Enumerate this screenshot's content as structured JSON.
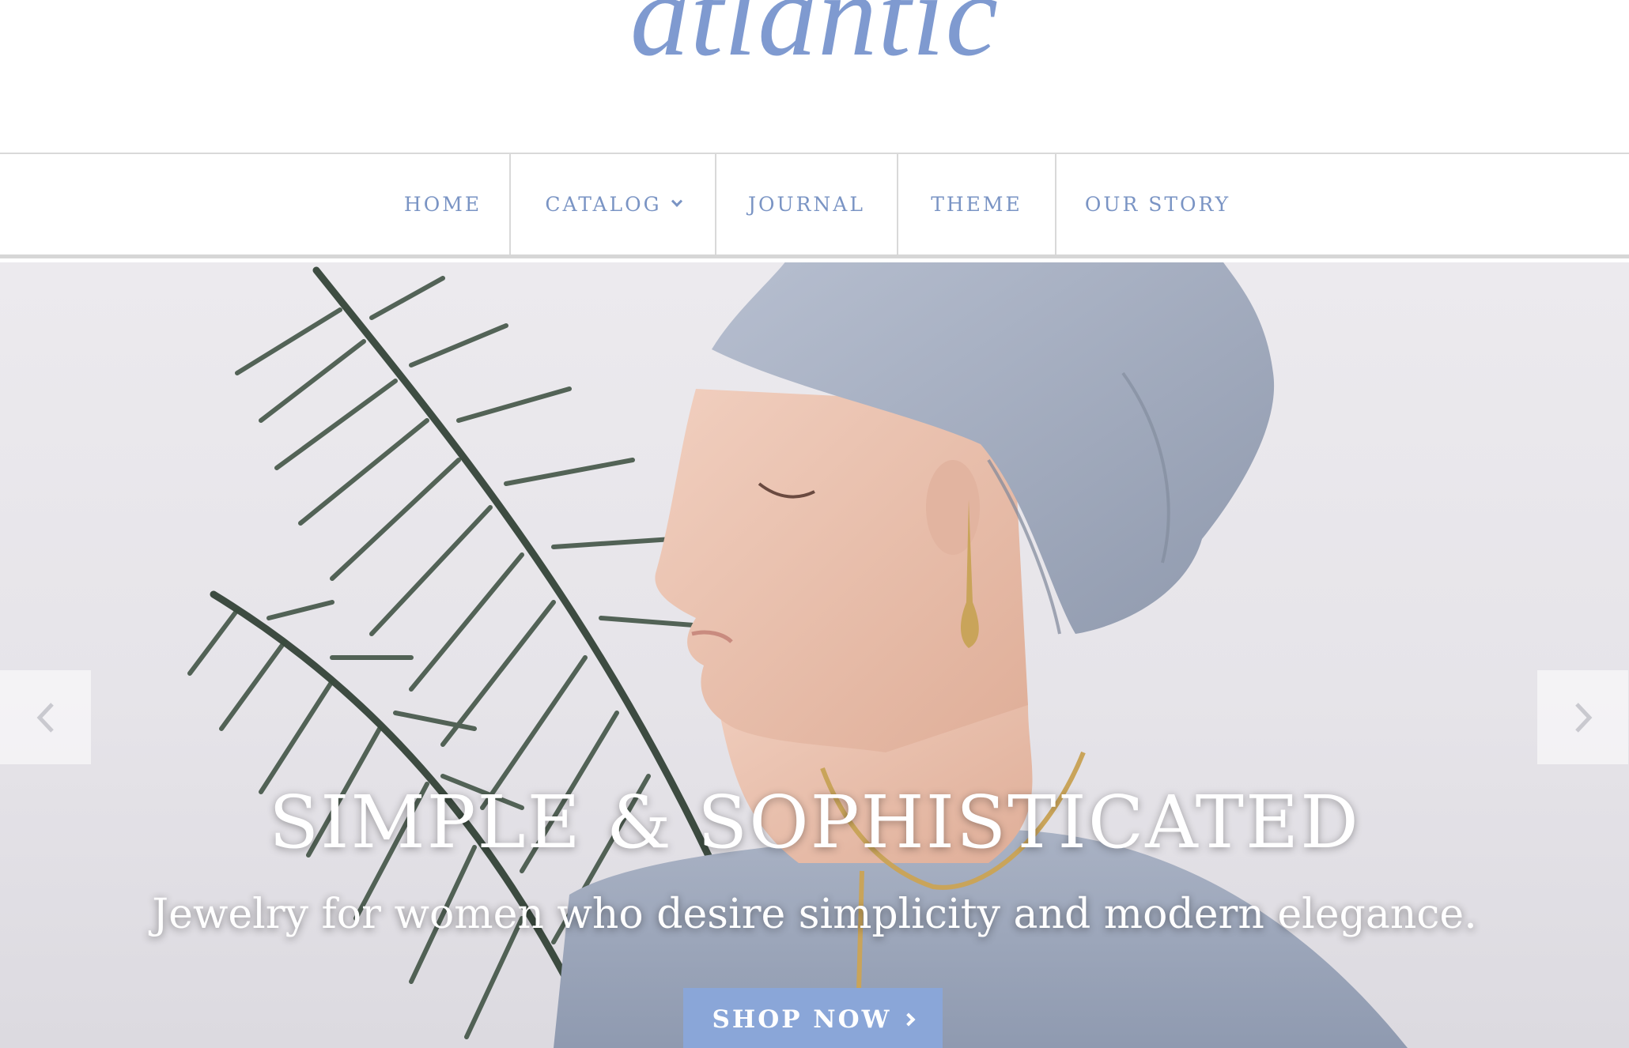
{
  "brand": {
    "logo_text": "atlantic",
    "accent": "#7f9ad0"
  },
  "nav": {
    "items": [
      {
        "label": "HOME"
      },
      {
        "label": "CATALOG",
        "has_dropdown": true
      },
      {
        "label": "JOURNAL"
      },
      {
        "label": "THEME"
      },
      {
        "label": "OUR STORY"
      }
    ]
  },
  "hero": {
    "title": "SIMPLE & SOPHISTICATED",
    "subtitle": "Jewelry for women who desire simplicity and modern elegance.",
    "cta_label": "SHOP NOW",
    "cta_color": "#8aa6d8",
    "prev_icon": "chevron-left-icon",
    "next_icon": "chevron-right-icon"
  }
}
